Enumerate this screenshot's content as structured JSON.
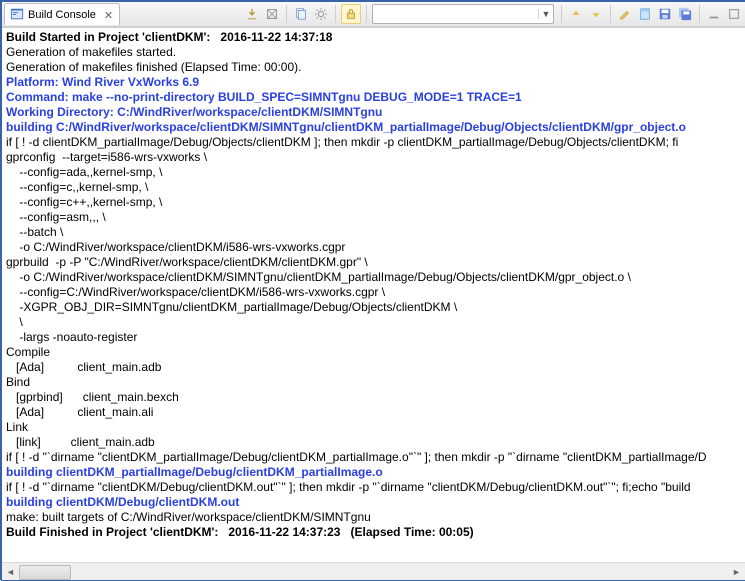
{
  "tab": {
    "title": "Build Console"
  },
  "toolbar": {
    "dropdown_value": ""
  },
  "console": {
    "lines": [
      {
        "cls": "bold black",
        "text": "Build Started in Project 'clientDKM':   2016-11-22 14:37:18"
      },
      {
        "cls": "black",
        "text": "Generation of makefiles started."
      },
      {
        "cls": "black",
        "text": "Generation of makefiles finished (Elapsed Time: 00:00)."
      },
      {
        "cls": "info",
        "text": "Platform: Wind River VxWorks 6.9"
      },
      {
        "cls": "info",
        "text": "Command: make --no-print-directory BUILD_SPEC=SIMNTgnu DEBUG_MODE=1 TRACE=1"
      },
      {
        "cls": "info",
        "text": "Working Directory: C:/WindRiver/workspace/clientDKM/SIMNTgnu"
      },
      {
        "cls": "build",
        "text": "building C:/WindRiver/workspace/clientDKM/SIMNTgnu/clientDKM_partialImage/Debug/Objects/clientDKM/gpr_object.o"
      },
      {
        "cls": "black",
        "text": "if [ ! -d clientDKM_partialImage/Debug/Objects/clientDKM ]; then mkdir -p clientDKM_partialImage/Debug/Objects/clientDKM; fi"
      },
      {
        "cls": "black",
        "text": "gprconfig  --target=i586-wrs-vxworks \\"
      },
      {
        "cls": "black",
        "text": "    --config=ada,,kernel-smp, \\"
      },
      {
        "cls": "black",
        "text": "    --config=c,,kernel-smp, \\"
      },
      {
        "cls": "black",
        "text": "    --config=c++,,kernel-smp, \\"
      },
      {
        "cls": "black",
        "text": "    --config=asm,,, \\"
      },
      {
        "cls": "black",
        "text": "    --batch \\"
      },
      {
        "cls": "black",
        "text": "    -o C:/WindRiver/workspace/clientDKM/i586-wrs-vxworks.cgpr"
      },
      {
        "cls": "black",
        "text": "gprbuild  -p -P \"C:/WindRiver/workspace/clientDKM/clientDKM.gpr\" \\"
      },
      {
        "cls": "black",
        "text": "    -o C:/WindRiver/workspace/clientDKM/SIMNTgnu/clientDKM_partialImage/Debug/Objects/clientDKM/gpr_object.o \\"
      },
      {
        "cls": "black",
        "text": "    --config=C:/WindRiver/workspace/clientDKM/i586-wrs-vxworks.cgpr \\"
      },
      {
        "cls": "black",
        "text": "    -XGPR_OBJ_DIR=SIMNTgnu/clientDKM_partialImage/Debug/Objects/clientDKM \\"
      },
      {
        "cls": "black",
        "text": "    \\"
      },
      {
        "cls": "black",
        "text": "    -largs -noauto-register"
      },
      {
        "cls": "black",
        "text": "Compile"
      },
      {
        "cls": "black",
        "text": "   [Ada]          client_main.adb"
      },
      {
        "cls": "black",
        "text": "Bind"
      },
      {
        "cls": "black",
        "text": "   [gprbind]      client_main.bexch"
      },
      {
        "cls": "black",
        "text": "   [Ada]          client_main.ali"
      },
      {
        "cls": "black",
        "text": "Link"
      },
      {
        "cls": "black",
        "text": "   [link]         client_main.adb"
      },
      {
        "cls": "black",
        "text": "if [ ! -d \"`dirname \"clientDKM_partialImage/Debug/clientDKM_partialImage.o\"`\" ]; then mkdir -p \"`dirname \"clientDKM_partialImage/D"
      },
      {
        "cls": "build",
        "text": "building clientDKM_partialImage/Debug/clientDKM_partialImage.o"
      },
      {
        "cls": "black",
        "text": "if [ ! -d \"`dirname \"clientDKM/Debug/clientDKM.out\"`\" ]; then mkdir -p \"`dirname \"clientDKM/Debug/clientDKM.out\"`\"; fi;echo \"build"
      },
      {
        "cls": "build",
        "text": "building clientDKM/Debug/clientDKM.out"
      },
      {
        "cls": "black",
        "text": "make: built targets of C:/WindRiver/workspace/clientDKM/SIMNTgnu"
      },
      {
        "cls": "bold black",
        "text": "Build Finished in Project 'clientDKM':   2016-11-22 14:37:23   (Elapsed Time: 00:05)"
      },
      {
        "cls": "black",
        "text": " "
      }
    ]
  }
}
